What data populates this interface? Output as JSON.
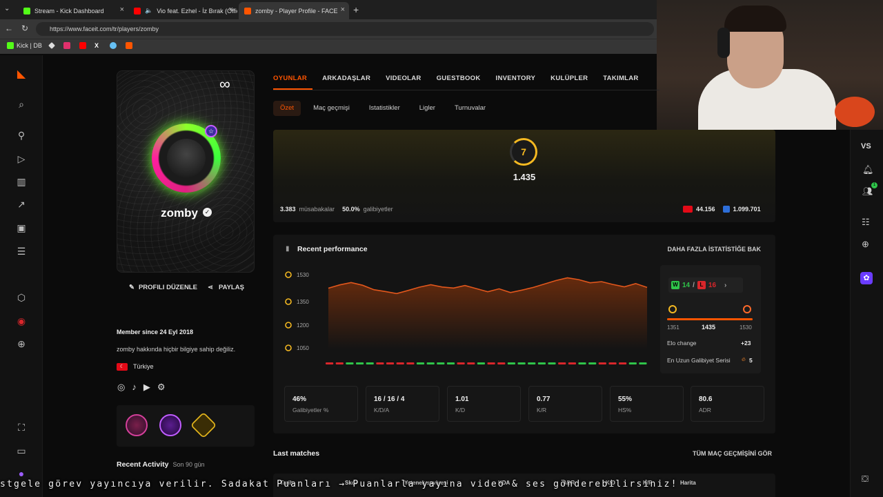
{
  "browser": {
    "tabs": [
      {
        "title": "Stream - Kick Dashboard",
        "active": false
      },
      {
        "title": "Vio feat. Ezhel - İz Bırak (Offic",
        "active": false
      },
      {
        "title": "zomby - Player Profile - FACEIT.co",
        "active": true
      }
    ],
    "url": "https://www.faceit.com/tr/players/zomby",
    "bookmarks": [
      {
        "label": "Kick | DB"
      }
    ]
  },
  "profile": {
    "username": "zomby",
    "edit_label": "PROFILI DÜZENLE",
    "share_label": "PAYLAŞ",
    "member_since": "Member since 24 Eyl 2018",
    "bio": "zomby hakkında hiçbir bilgiye sahip değiliz.",
    "country": "Türkiye",
    "recent_activity": "Recent Activity",
    "recent_activity_range": "Son 90 gün"
  },
  "nav": {
    "main_tabs": [
      "OYUNLAR",
      "ARKADAŞLAR",
      "VIDEOLAR",
      "GUESTBOOK",
      "INVENTORY",
      "KULÜPLER",
      "TAKIMLAR"
    ],
    "sub_tabs": [
      "Özet",
      "Maç geçmişi",
      "Istatistikler",
      "Ligler",
      "Turnuvalar"
    ]
  },
  "elo": {
    "level": "7",
    "value": "1.435",
    "matches_count": "3.383",
    "matches_label": "müsabakalar",
    "winrate": "50.0%",
    "winrate_label": "galibiyetler",
    "country_rank": "44.156",
    "region_rank": "1.099.701"
  },
  "performance": {
    "title": "Recent performance",
    "more_stats": "DAHA FAZLA İSTATİSTİĞE BAK",
    "wins": "14",
    "losses": "16",
    "range_min": "1351",
    "range_current": "1435",
    "range_max": "1530",
    "elo_change_label": "Elo change",
    "elo_change": "+23",
    "streak_label": "En Uzun Galibiyet Serisi",
    "streak": "5"
  },
  "chart_data": {
    "type": "line",
    "ylim": [
      1050,
      1530
    ],
    "y_ticks": [
      "1530",
      "1350",
      "1200",
      "1050"
    ],
    "series": [
      {
        "values": [
          1440,
          1462,
          1478,
          1460,
          1430,
          1418,
          1404,
          1425,
          1447,
          1463,
          1448,
          1441,
          1458,
          1437,
          1416,
          1436,
          1411,
          1427,
          1445,
          1468,
          1491,
          1509,
          1497,
          1476,
          1484,
          1465,
          1449,
          1471,
          1445
        ]
      }
    ],
    "results": [
      "L",
      "L",
      "W",
      "W",
      "W",
      "L",
      "L",
      "L",
      "L",
      "W",
      "W",
      "W",
      "W",
      "L",
      "L",
      "W",
      "L",
      "L",
      "W",
      "W",
      "W",
      "W",
      "W",
      "L",
      "L",
      "W",
      "W",
      "L",
      "L",
      "L",
      "W",
      "W"
    ]
  },
  "stats": [
    {
      "value": "46%",
      "label": "Galibiyetler %"
    },
    {
      "value": "16 / 16 / 4",
      "label": "K/D/A"
    },
    {
      "value": "1.01",
      "label": "K/D"
    },
    {
      "value": "0.77",
      "label": "K/R"
    },
    {
      "value": "55%",
      "label": "HS%"
    },
    {
      "value": "80.6",
      "label": "ADR"
    }
  ],
  "last_matches": {
    "title": "Last matches",
    "all_link": "TÜM MAÇ GEÇMİŞİNİ GÖR",
    "columns": [
      "Tarih",
      "Skor",
      "Yetenek seviyesi",
      "KDA",
      "ADR",
      "K/D",
      "K/R",
      "Harita"
    ]
  },
  "right_rail": {
    "vs_label": "VS",
    "notif_badge": "1"
  },
  "ticker": "stgele görev yayıncıya verilir. Sadakat Puanları → Puanlarla yayına video & ses gönderebilirsiniz!",
  "colors": {
    "accent": "#ff5500",
    "win": "#2fc44a",
    "loss": "#d9262b",
    "ring_green": "#6eff32"
  }
}
